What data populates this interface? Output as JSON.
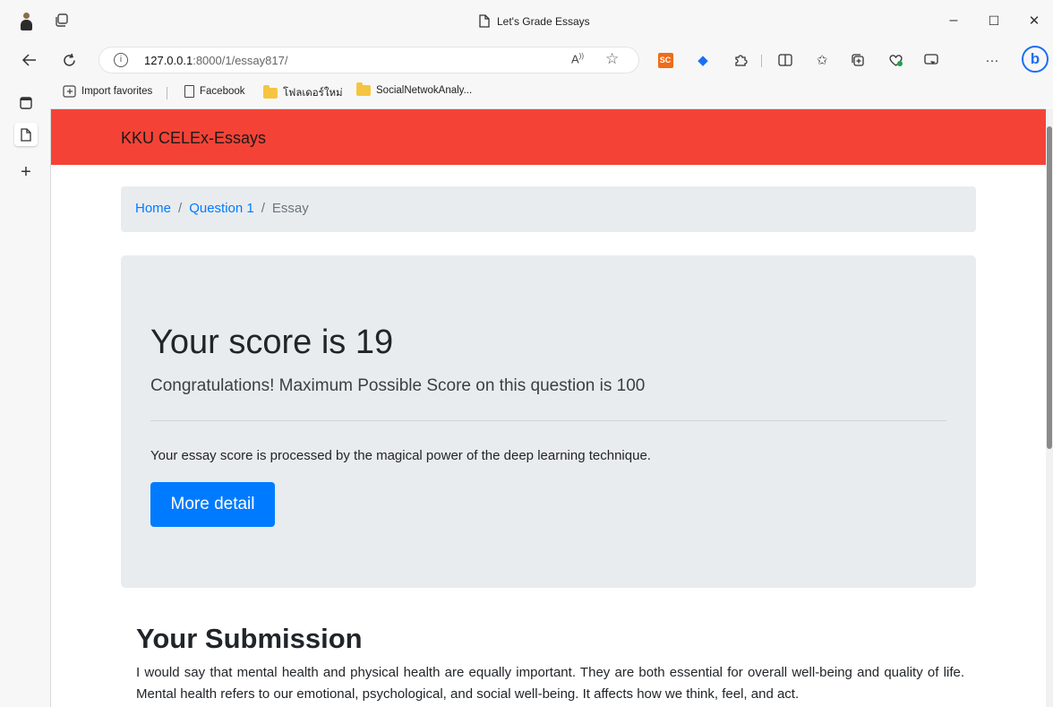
{
  "window": {
    "tab_title": "Let's Grade Essays",
    "minimize": "–",
    "maximize": "☐",
    "close": "✕"
  },
  "address": {
    "url_host": "127.0.0.1",
    "url_rest": ":8000/1/essay817/",
    "read_aloud": "À̧",
    "more": "···"
  },
  "bookmarks": [
    "Import favorites",
    "Facebook",
    "โฟลเดอร์ใหม่",
    "SocialNetwokAnaly..."
  ],
  "site": {
    "brand": "KKU CELEx-Essays",
    "accent_color": "#f44336",
    "link_color": "#007bff"
  },
  "breadcrumb": {
    "home": "Home",
    "question": "Question 1",
    "current": "Essay",
    "separator": "/"
  },
  "result": {
    "heading": "Your score is 19",
    "lead": "Congratulations! Maximum Possible Score on this question is 100",
    "note": "Your essay score is processed by the magical power of the deep learning technique.",
    "button": "More detail"
  },
  "submission": {
    "heading": "Your Submission",
    "text": "I would say that mental health and physical health are equally important. They are both essential for overall well-being and quality of life. Mental health refers to our emotional, psychological, and social well-being. It affects how we think, feel, and act."
  },
  "icons": {
    "back": "back-arrow-icon",
    "refresh": "refresh-icon",
    "info": "info-icon",
    "favorite": "star-icon",
    "bing": "bing-icon"
  }
}
